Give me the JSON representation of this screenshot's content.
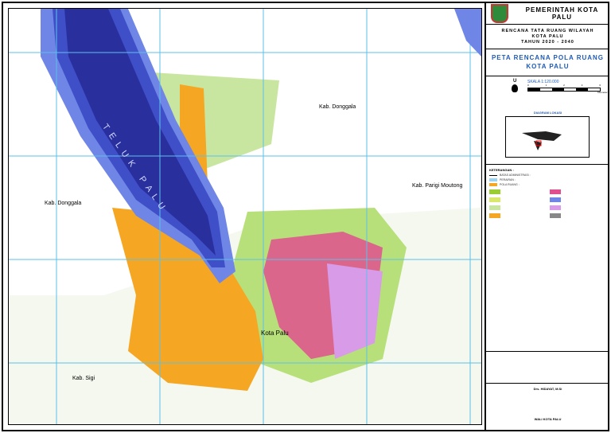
{
  "map": {
    "labels": {
      "bay": "T E L U K   P A L U",
      "donggala_ne": "Kab. Donggala",
      "donggala_w": "Kab. Donggala",
      "parigi": "Kab. Parigi Moutong",
      "sigi": "Kab. Sigi",
      "palu": "Kota Palu"
    },
    "colors": {
      "bay_deep": "#2a2f9e",
      "bay_mid": "#3f4fc8",
      "bay_shallow": "#6f86e6",
      "urban": "#f5a623",
      "protected": "#d9e86a",
      "forest": "#9acd32",
      "pink": "#e0508f",
      "grid": "#5bc0eb"
    }
  },
  "panel": {
    "header": "PEMERINTAH KOTA PALU",
    "plan_title": [
      "RENCANA TATA RUANG WILAYAH",
      "KOTA PALU",
      "TAHUN 2020 - 2040"
    ],
    "map_title": [
      "PETA RENCANA POLA RUANG",
      "KOTA PALU"
    ],
    "north": "U",
    "scale": "SKALA 1:120.000",
    "scale_ticks": [
      "0",
      "1",
      "2",
      "4",
      "6"
    ],
    "scale_unit": "Kilometer",
    "inset_title": "DIAGRAM LOKASI",
    "legend_title": "KETERANGAN :",
    "legend_groups": [
      "BATAS ADMINISTRASI :",
      "PERAIRAN :",
      "POLA RUANG :"
    ],
    "signature_name": "Drs. HIDAYAT, M.Si",
    "signature_title": "WALI KOTA PALU",
    "title_color": "#1e5bb8"
  }
}
